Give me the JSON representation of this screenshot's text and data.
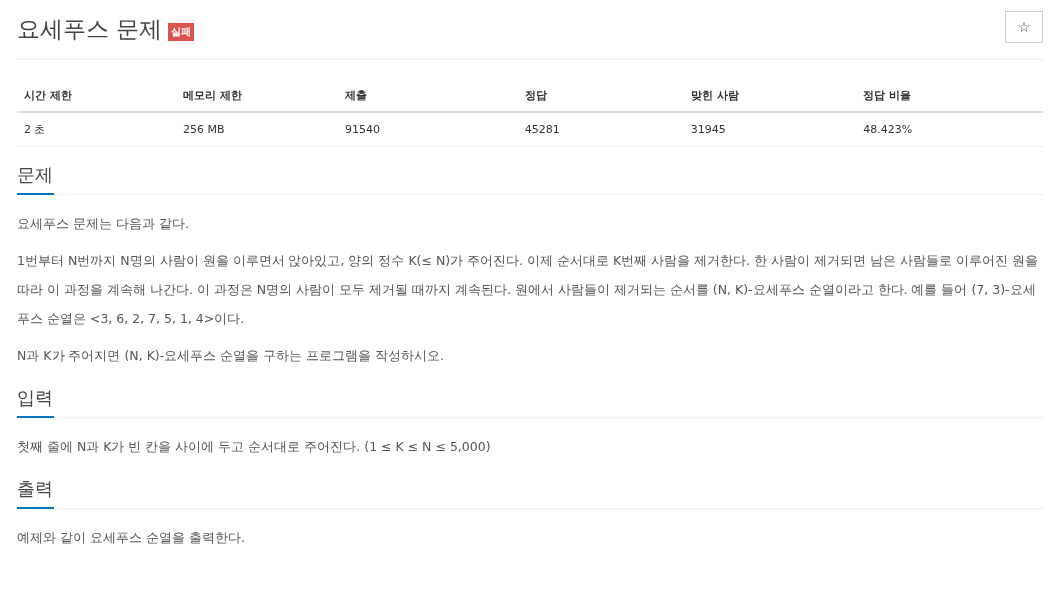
{
  "title": "요세푸스 문제",
  "badge": "실패",
  "star_button": "☆",
  "info_table": {
    "columns": [
      "시간 제한",
      "메모리 제한",
      "제출",
      "정답",
      "맞힌 사람",
      "정답 비율"
    ],
    "rows": [
      [
        "2 초",
        "256 MB",
        "91540",
        "45281",
        "31945",
        "48.423%"
      ]
    ]
  },
  "sections": [
    {
      "heading": "문제",
      "paragraphs": [
        "요세푸스 문제는 다음과 같다.",
        "1번부터 N번까지 N명의 사람이 원을 이루면서 앉아있고, 양의 정수 K(≤ N)가 주어진다. 이제 순서대로 K번째 사람을 제거한다. 한 사람이 제거되면 남은 사람들로 이루어진 원을 따라 이 과정을 계속해 나간다. 이 과정은 N명의 사람이 모두 제거될 때까지 계속된다. 원에서 사람들이 제거되는 순서를 (N, K)-요세푸스 순열이라고 한다. 예를 들어 (7, 3)-요세푸스 순열은 <3, 6, 2, 7, 5, 1, 4>이다.",
        "N과 K가 주어지면 (N, K)-요세푸스 순열을 구하는 프로그램을 작성하시오."
      ]
    },
    {
      "heading": "입력",
      "paragraphs": [
        "첫째 줄에 N과 K가 빈 칸을 사이에 두고 순서대로 주어진다. (1 ≤ K ≤ N ≤ 5,000)"
      ]
    },
    {
      "heading": "출력",
      "paragraphs": [
        "예제와 같이 요세푸스 순열을 출력한다."
      ]
    }
  ]
}
